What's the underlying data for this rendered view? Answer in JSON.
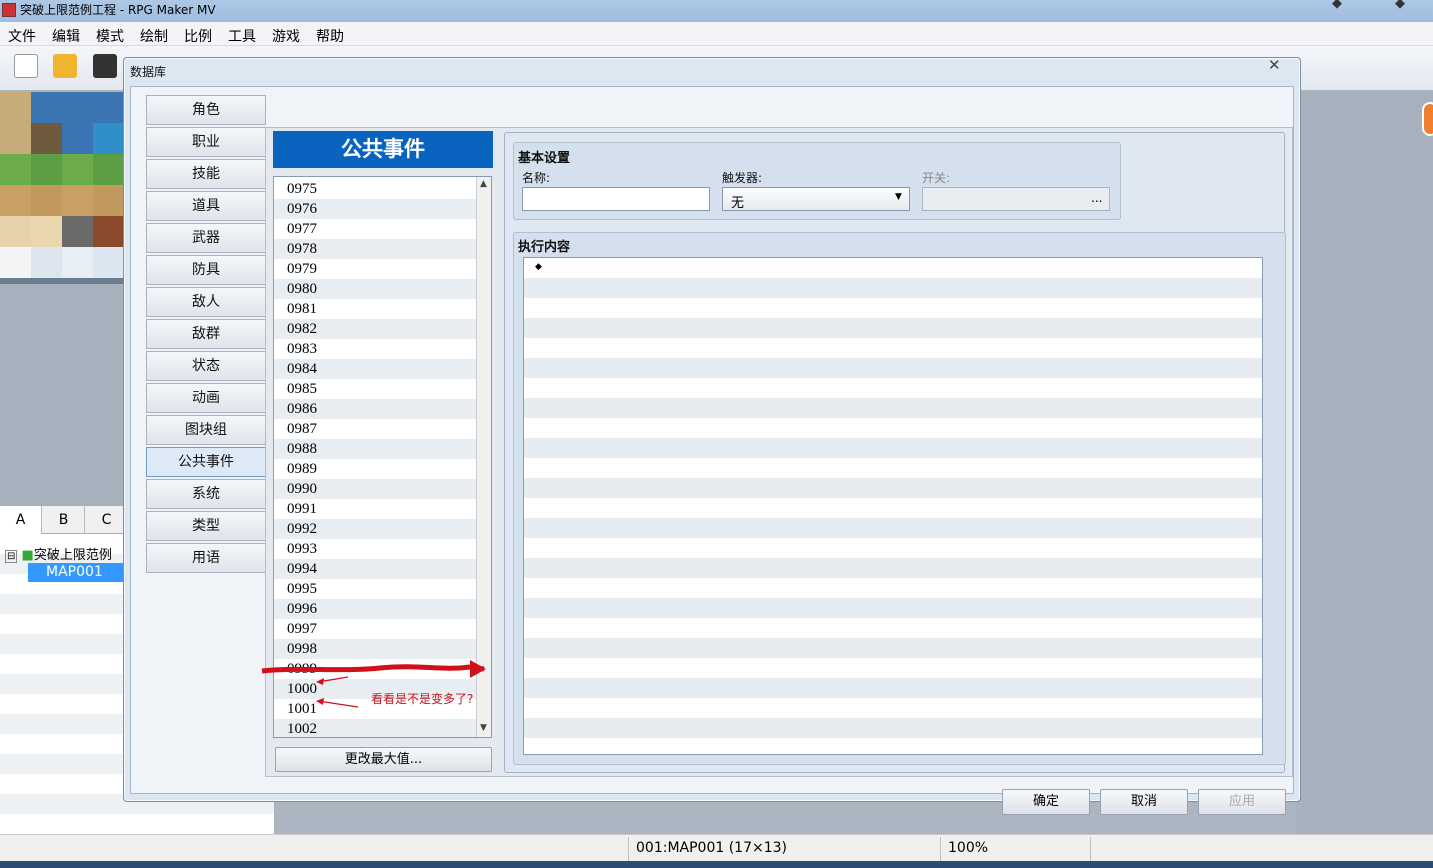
{
  "window": {
    "title": "突破上限范例工程 - RPG Maker MV"
  },
  "menubar": [
    "文件",
    "编辑",
    "模式",
    "绘制",
    "比例",
    "工具",
    "游戏",
    "帮助"
  ],
  "left_tabs": [
    "A",
    "B",
    "C"
  ],
  "map_tree": {
    "root": "突破上限范例",
    "selected": "MAP001"
  },
  "statusbar": {
    "map": "001:MAP001 (17×13)",
    "zoom": "100%"
  },
  "dialog": {
    "title": "数据库",
    "close_glyph": "✕",
    "tabs": [
      "角色",
      "职业",
      "技能",
      "道具",
      "武器",
      "防具",
      "敌人",
      "敌群",
      "状态",
      "动画",
      "图块组",
      "公共事件",
      "系统",
      "类型",
      "用语"
    ],
    "active_tab": "公共事件",
    "list": {
      "header": "公共事件",
      "items": [
        "0975",
        "0976",
        "0977",
        "0978",
        "0979",
        "0980",
        "0981",
        "0982",
        "0983",
        "0984",
        "0985",
        "0986",
        "0987",
        "0988",
        "0989",
        "0990",
        "0991",
        "0992",
        "0993",
        "0994",
        "0995",
        "0996",
        "0997",
        "0998",
        "0999",
        "1000",
        "1001",
        "1002"
      ],
      "max_button": "更改最大值..."
    },
    "basic": {
      "title": "基本设置",
      "name_label": "名称:",
      "name_value": "",
      "trigger_label": "触发器:",
      "trigger_value": "无",
      "switch_label": "开关:",
      "switch_button": "..."
    },
    "exec": {
      "title": "执行内容",
      "first_line": "◆"
    },
    "buttons": {
      "ok": "确定",
      "cancel": "取消",
      "apply": "应用"
    },
    "annotation": "看看是不是变多了?"
  },
  "colors": {
    "header_blue": "#0a63bf",
    "selection": "#3399ff",
    "annotation_red": "#c8141e"
  }
}
